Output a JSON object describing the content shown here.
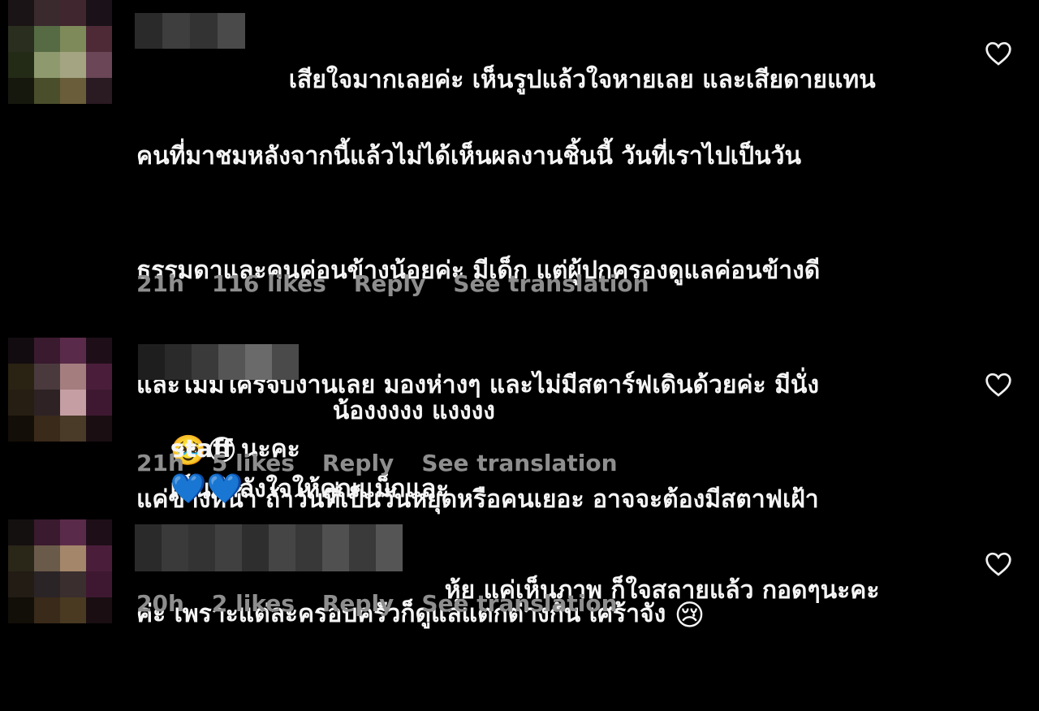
{
  "comments": [
    {
      "text_line1_after_name": "เสียใจมากเลยค่ะ เห็นรูปแล้วใจหายเลย และเสียดายแทน",
      "text_lines": [
        "คนที่มาชมหลังจากนี้แล้วไม่ได้เห็นผลงานชิ้นนี้ วันที่เราไปเป็นวัน",
        "ธรรมดาและคนค่อนข้างน้อยค่ะ มีเด็ก แต่ผู้ปกครองดูแลค่อนข้างดี",
        "และไม่มีใครจับงานเลย มองห่างๆ และไม่มีสตาร์ฟเดินด้วยค่ะ มีนั่ง",
        "แค่ข้างหน้า ถ้าวันที่เป็นวันหยุดหรือคนเยอะ อาจจะต้องมีสตาฟเฝ้า",
        "ค่ะ เพราะแต่ละครอบครัวก็ดูแลแตกต่างกัน เศร้าจัง"
      ],
      "trailing_emoji": "😢",
      "time": "21h",
      "likes": "116 likes",
      "reply": "Reply",
      "see_translation": "See translation"
    },
    {
      "text_line1_after_name": "น้องงงงง แงงงง",
      "emoji_mid": "🥹😢",
      "text_line1_tail": "เป็นกำลังใจให้คุณแม็กและ",
      "text_line2": "staff นะคะ",
      "trailing_emoji": "💙💙",
      "time": "21h",
      "likes": "5 likes",
      "reply": "Reply",
      "see_translation": "See translation"
    },
    {
      "text_line1_after_name": "หุ้ย แค่เห็นภาพ ก็ใจสลายแล้ว กอดๆนะคะ",
      "time": "20h",
      "likes": "2 likes",
      "reply": "Reply",
      "see_translation": "See translation"
    }
  ],
  "colors": {
    "background": "#000000",
    "text": "#f5f5f5",
    "meta": "#8e8e8e"
  },
  "icons": {
    "like": "heart-outline-icon"
  }
}
